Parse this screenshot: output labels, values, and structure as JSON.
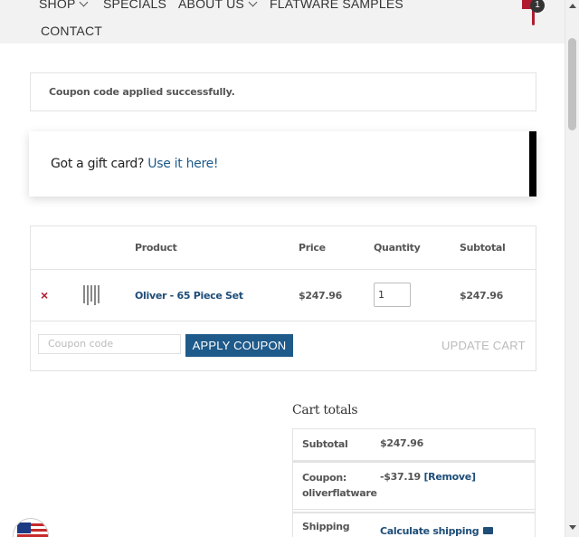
{
  "nav": {
    "items": [
      {
        "label": "SHOP",
        "has_dropdown": true
      },
      {
        "label": "SPECIALS",
        "has_dropdown": false
      },
      {
        "label": "ABOUT US",
        "has_dropdown": true
      },
      {
        "label": "FLATWARE SAMPLES",
        "has_dropdown": false
      },
      {
        "label": "CONTACT",
        "has_dropdown": false
      }
    ],
    "cart_count": "1",
    "cart_icon": "shopping-bag-icon"
  },
  "notice": {
    "message": "Coupon code applied successfully."
  },
  "giftcard": {
    "text": "Got a gift card?",
    "link": "Use it here!"
  },
  "cart": {
    "headers": {
      "product": "Product",
      "price": "Price",
      "quantity": "Quantity",
      "subtotal": "Subtotal"
    },
    "items": [
      {
        "remove": "×",
        "name": "Oliver - 65 Piece Set",
        "price": "$247.96",
        "quantity": "1",
        "subtotal": "$247.96"
      }
    ],
    "coupon_placeholder": "Coupon code",
    "apply_label": "APPLY COUPON",
    "update_label": "UPDATE CART"
  },
  "totals": {
    "title": "Cart totals",
    "subtotal_label": "Subtotal",
    "subtotal_value": "$247.96",
    "coupon_label": "Coupon:",
    "coupon_code": "oliverflatware",
    "coupon_value": "-$37.19",
    "coupon_remove": "[Remove]",
    "shipping_label": "Shipping",
    "shipping_link": "Calculate shipping"
  },
  "colors": {
    "accent": "#1e5a8a",
    "link": "#1e4d78",
    "brand_red": "#b01c2e"
  }
}
